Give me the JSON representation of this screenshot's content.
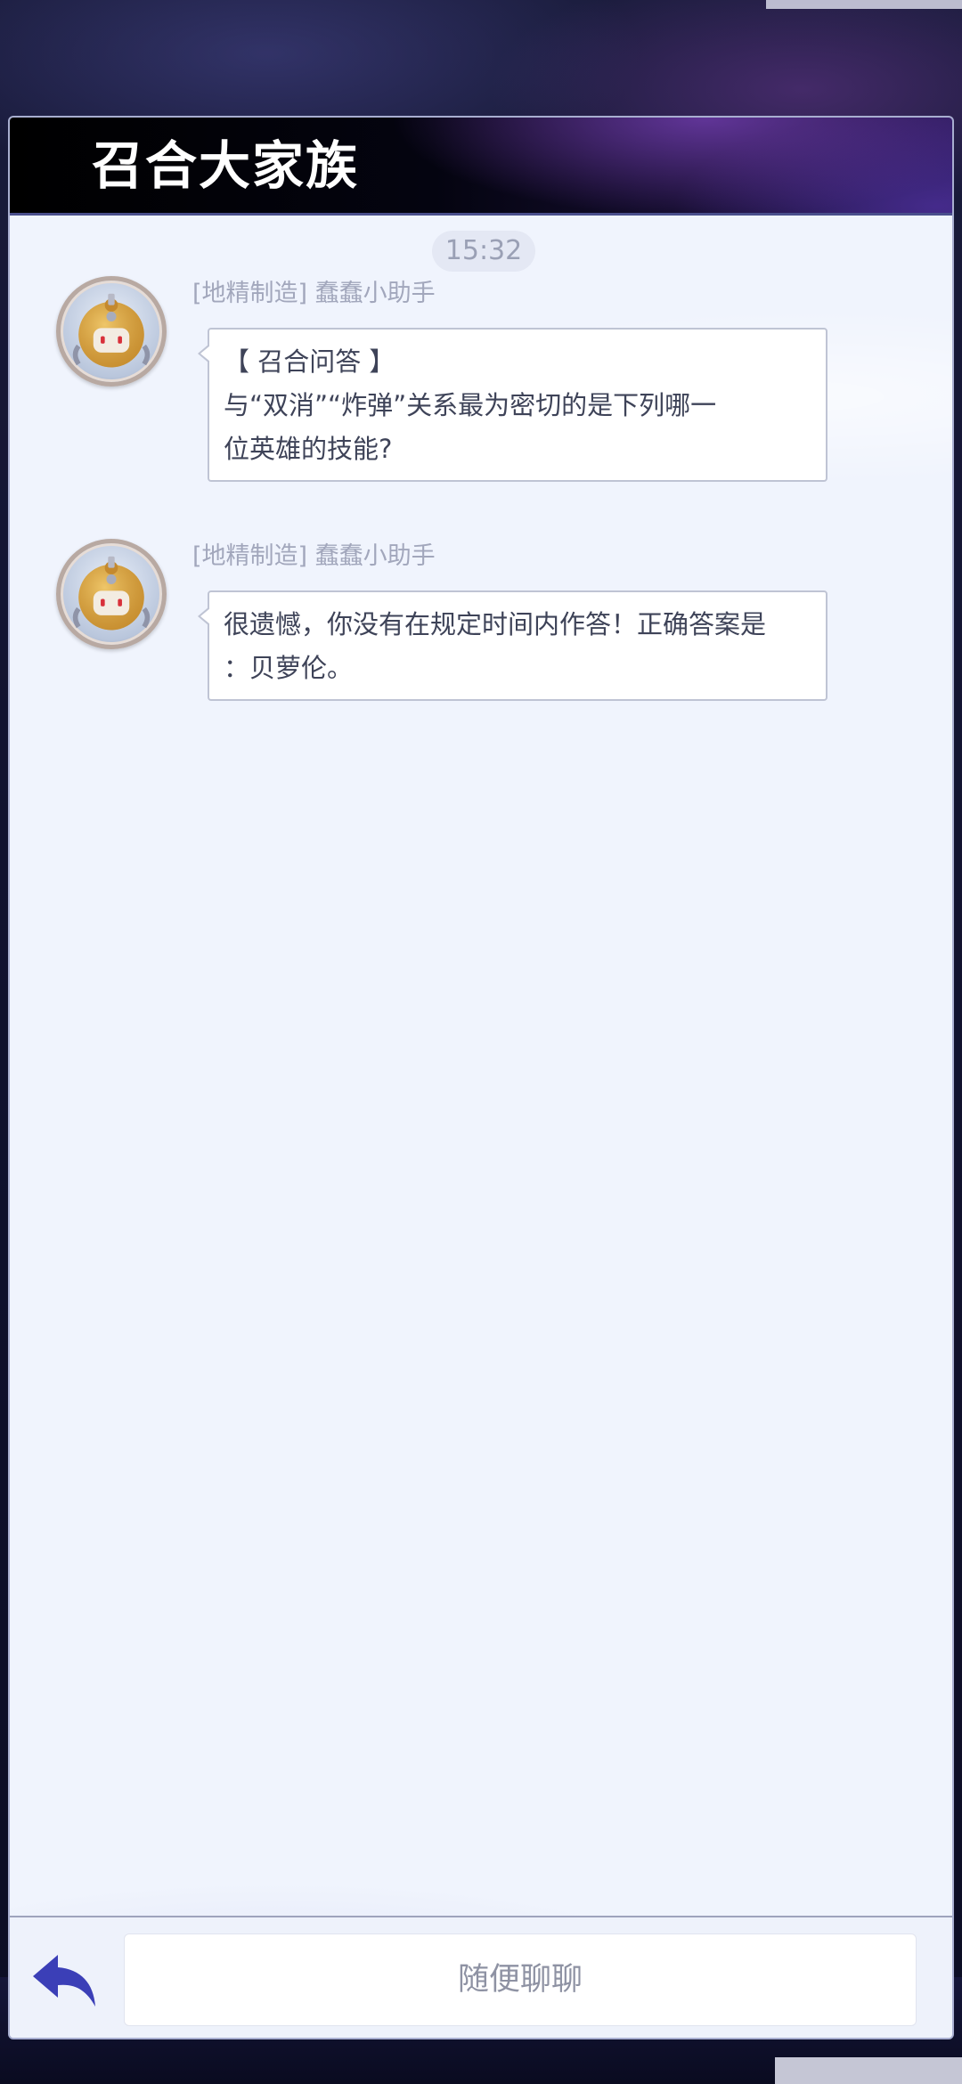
{
  "window": {
    "title": "召合大家族"
  },
  "chat": {
    "timestamp": "15:32",
    "messages": [
      {
        "sender": "[地精制造] 蠢蠢小助手",
        "avatar_icon": "robot-avatar-icon",
        "lines": [
          "【 召合问答 】",
          "与“双消”“炸弹”关系最为密切的是下列哪一",
          "位英雄的技能?"
        ]
      },
      {
        "sender": "[地精制造] 蠢蠢小助手",
        "avatar_icon": "robot-avatar-icon",
        "lines": [
          "很遗憾，你没有在规定时间内作答！正确答案是",
          "：贝萝伦。"
        ]
      }
    ]
  },
  "footer": {
    "back_icon": "reply-arrow-icon",
    "input_placeholder": "随便聊聊"
  },
  "colors": {
    "accent": "#3b3fb7",
    "panel_bg": "#f0f4fd",
    "header_bg": "#000000",
    "bubble_border": "#bfc4d4",
    "sender_text": "#a2a7bc"
  }
}
